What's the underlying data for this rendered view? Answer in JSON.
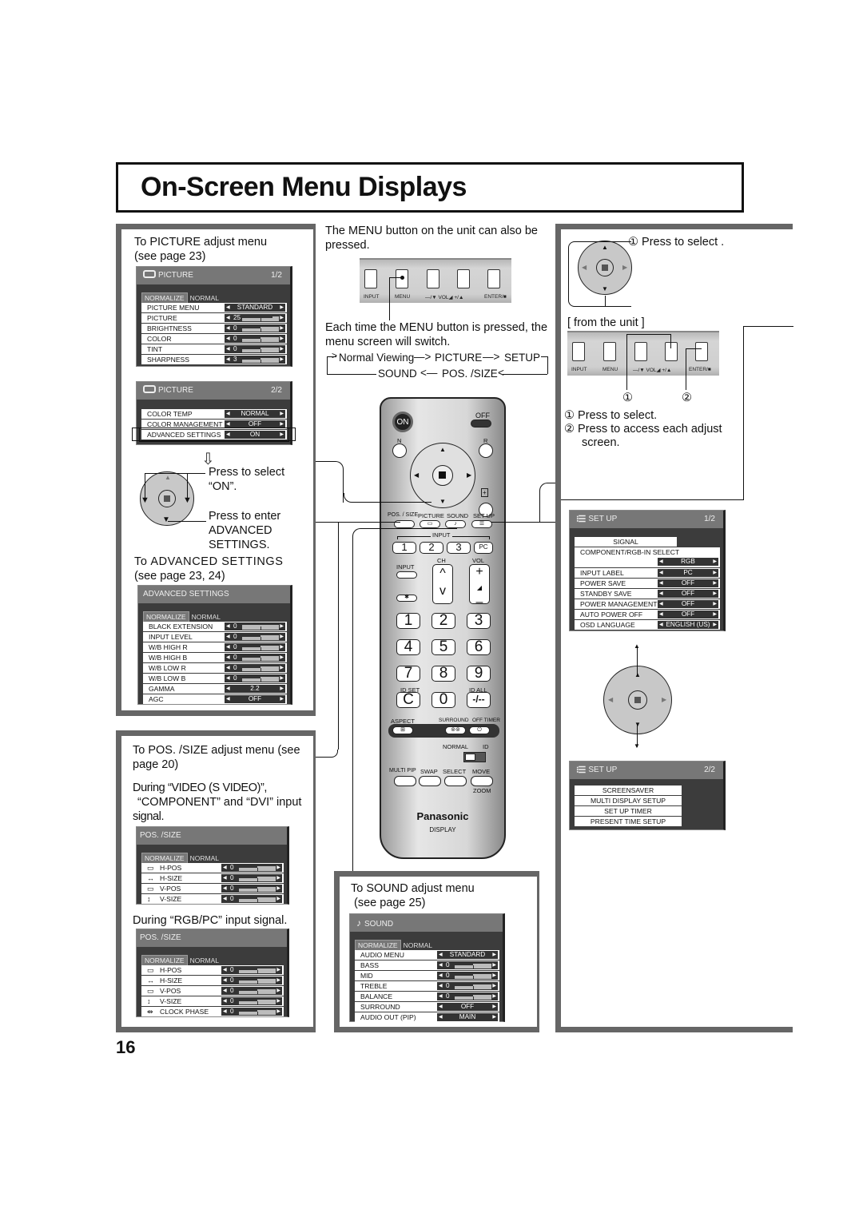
{
  "page": {
    "title": "On-Screen Menu Displays",
    "page_number": "16"
  },
  "left": {
    "picture_intro_1": "To PICTURE adjust menu",
    "picture_intro_2": "(see page 23)",
    "picture_menu_1": {
      "title": "PICTURE",
      "page": "1/2",
      "normalize": "NORMALIZE",
      "normal": "NORMAL",
      "rows": [
        {
          "label": "PICTURE MENU",
          "value": "STANDARD",
          "type": "option"
        },
        {
          "label": "PICTURE",
          "value": "25",
          "type": "slider",
          "level": 0.83
        },
        {
          "label": "BRIGHTNESS",
          "value": "0",
          "type": "slider",
          "level": 0.5
        },
        {
          "label": "COLOR",
          "value": "0",
          "type": "slider",
          "level": 0.5
        },
        {
          "label": "TINT",
          "value": "0",
          "type": "slider",
          "level": 0.5
        },
        {
          "label": "SHARPNESS",
          "value": "3",
          "type": "slider",
          "level": 0.5
        }
      ]
    },
    "picture_menu_2": {
      "title": "PICTURE",
      "page": "2/2",
      "rows": [
        {
          "label": "COLOR TEMP",
          "value": "NORMAL",
          "type": "option"
        },
        {
          "label": "COLOR MANAGEMENT",
          "value": "OFF",
          "type": "option"
        },
        {
          "label": "ADVANCED SETTINGS",
          "value": "ON",
          "type": "option",
          "highlighted": true
        }
      ]
    },
    "press_select_1": "Press  to  select",
    "press_select_2": "“ON”.",
    "press_enter_1": "Press to enter",
    "press_enter_2": "ADVANCED",
    "press_enter_3": "SETTINGS.",
    "advanced_intro_1": "To ADVANCED SETTINGS",
    "advanced_intro_2": "(see page 23, 24)",
    "advanced_menu": {
      "title": "ADVANCED SETTINGS",
      "normalize": "NORMALIZE",
      "normal": "NORMAL",
      "rows": [
        {
          "label": "BLACK EXTENSION",
          "value": "0",
          "type": "slider",
          "level": 0.0
        },
        {
          "label": "INPUT LEVEL",
          "value": "0",
          "type": "slider",
          "level": 0.5
        },
        {
          "label": "W/B HIGH R",
          "value": "0",
          "type": "slider",
          "level": 0.5
        },
        {
          "label": "W/B HIGH B",
          "value": "0",
          "type": "slider",
          "level": 0.5
        },
        {
          "label": "W/B LOW R",
          "value": "0",
          "type": "slider",
          "level": 0.5
        },
        {
          "label": "W/B LOW B",
          "value": "0",
          "type": "slider",
          "level": 0.5
        },
        {
          "label": "GAMMA",
          "value": "2.2",
          "type": "option"
        },
        {
          "label": "AGC",
          "value": "OFF",
          "type": "option"
        }
      ]
    },
    "pos_intro_1": "To POS. /SIZE adjust menu (see",
    "pos_intro_2": "page 20)",
    "pos_during_1": "During “VIDEO (S VIDEO)”,",
    "pos_during_2": "“COMPONENT” and “DVI” input",
    "pos_during_3": "signal.",
    "pos_menu_video": {
      "title": "POS. /SIZE",
      "normalize": "NORMALIZE",
      "normal": "NORMAL",
      "rows": [
        {
          "label": "H-POS",
          "icon": "h-pos-icon",
          "glyph": "▭",
          "value": "0",
          "type": "slider",
          "level": 0.5
        },
        {
          "label": "H-SIZE",
          "icon": "h-size-icon",
          "glyph": "↔",
          "value": "0",
          "type": "slider",
          "level": 0.5
        },
        {
          "label": "V-POS",
          "icon": "v-pos-icon",
          "glyph": "▭",
          "value": "0",
          "type": "slider",
          "level": 0.5
        },
        {
          "label": "V-SIZE",
          "icon": "v-size-icon",
          "glyph": "↕",
          "value": "0",
          "type": "slider",
          "level": 0.5
        }
      ]
    },
    "pos_rgb_caption": "During “RGB/PC” input signal.",
    "pos_menu_rgb": {
      "title": "POS. /SIZE",
      "normalize": "NORMALIZE",
      "normal": "NORMAL",
      "rows": [
        {
          "label": "H-POS",
          "icon": "h-pos-icon",
          "glyph": "▭",
          "value": "0",
          "type": "slider",
          "level": 0.5
        },
        {
          "label": "H-SIZE",
          "icon": "h-size-icon",
          "glyph": "↔",
          "value": "0",
          "type": "slider",
          "level": 0.5
        },
        {
          "label": "V-POS",
          "icon": "v-pos-icon",
          "glyph": "▭",
          "value": "0",
          "type": "slider",
          "level": 0.5
        },
        {
          "label": "V-SIZE",
          "icon": "v-size-icon",
          "glyph": "↕",
          "value": "0",
          "type": "slider",
          "level": 0.5
        },
        {
          "label": "CLOCK PHASE",
          "icon": "clock-phase-icon",
          "glyph": "⇹",
          "value": "0",
          "type": "slider",
          "level": 0.5
        }
      ]
    }
  },
  "center": {
    "menu_note_1": "The MENU button on the unit can also be",
    "menu_note_2": "pressed.",
    "unit_labels": [
      "INPUT",
      "MENU",
      "—/▼ VOL◢ +/▲",
      "ENTER/■"
    ],
    "switch_note_1": "Each time the MENU button is pressed, the",
    "switch_note_2": "menu screen will switch.",
    "cycle": {
      "normal_viewing": "Normal Viewing",
      "picture": "PICTURE",
      "setup": "SETUP",
      "sound": "SOUND",
      "pos_size": "POS. /SIZE"
    },
    "remote": {
      "on": "ON",
      "off": "OFF",
      "n": "N",
      "r": "R",
      "pos_size": "POS. / SIZE",
      "picture": "PICTURE",
      "sound": "SOUND",
      "set_up": "SET UP",
      "input_group": "INPUT",
      "inputs": [
        "1",
        "2",
        "3",
        "PC"
      ],
      "input": "INPUT",
      "ch": "CH",
      "vol": "VOL",
      "digits": [
        "1",
        "2",
        "3",
        "4",
        "5",
        "6",
        "7",
        "8",
        "9",
        "C",
        "0",
        "-/--"
      ],
      "id_set": "ID SET",
      "id_all": "ID ALL",
      "aspect": "ASPECT",
      "surround": "SURROUND",
      "off_timer": "OFF TIMER",
      "normal": "NORMAL",
      "id": "ID",
      "multi_pip": "MULTI PIP",
      "swap": "SWAP",
      "select": "SELECT",
      "move": "MOVE",
      "zoom": "ZOOM",
      "brand": "Panasonic",
      "model": "DISPLAY"
    },
    "sound_intro_1": "To SOUND adjust menu",
    "sound_intro_2": "(see page 25)",
    "sound_menu": {
      "title": "SOUND",
      "normalize": "NORMALIZE",
      "normal": "NORMAL",
      "rows": [
        {
          "label": "AUDIO MENU",
          "value": "STANDARD",
          "type": "option"
        },
        {
          "label": "BASS",
          "value": "0",
          "type": "slider",
          "level": 0.5
        },
        {
          "label": "MID",
          "value": "0",
          "type": "slider",
          "level": 0.5
        },
        {
          "label": "TREBLE",
          "value": "0",
          "type": "slider",
          "level": 0.5
        },
        {
          "label": "BALANCE",
          "value": "0",
          "type": "slider",
          "level": 0.5
        },
        {
          "label": "SURROUND",
          "value": "OFF",
          "type": "option"
        },
        {
          "label": "AUDIO OUT (PIP)",
          "value": "MAIN",
          "type": "option"
        }
      ]
    }
  },
  "right": {
    "press_select_top": "① Press to select .",
    "from_unit": "[ from the unit ]",
    "unit_labels": [
      "INPUT",
      "MENU",
      "—/▼ VOL◢ +/▲",
      "ENTER/■"
    ],
    "callout_1": "①",
    "callout_2": "②",
    "note_1": "① Press to select.",
    "note_2a": "② Press to access each adjust",
    "note_2b": "screen.",
    "setup_menu_1": {
      "title": "SET UP",
      "page": "1/2",
      "signal": "SIGNAL",
      "component_select": "COMPONENT/RGB-IN SELECT",
      "component_value": "RGB",
      "rows": [
        {
          "label": "INPUT LABEL",
          "value": "PC"
        },
        {
          "label": "POWER SAVE",
          "value": "OFF"
        },
        {
          "label": "STANDBY SAVE",
          "value": "OFF"
        },
        {
          "label": "POWER MANAGEMENT",
          "value": "OFF"
        },
        {
          "label": "AUTO POWER OFF",
          "value": "OFF"
        },
        {
          "label": "OSD LANGUAGE",
          "value": "ENGLISH (US)"
        }
      ]
    },
    "setup_menu_2": {
      "title": "SET UP",
      "page": "2/2",
      "items": [
        "SCREENSAVER",
        "MULTI DISPLAY SETUP",
        "SET UP TIMER",
        "PRESENT TIME SETUP"
      ]
    }
  }
}
